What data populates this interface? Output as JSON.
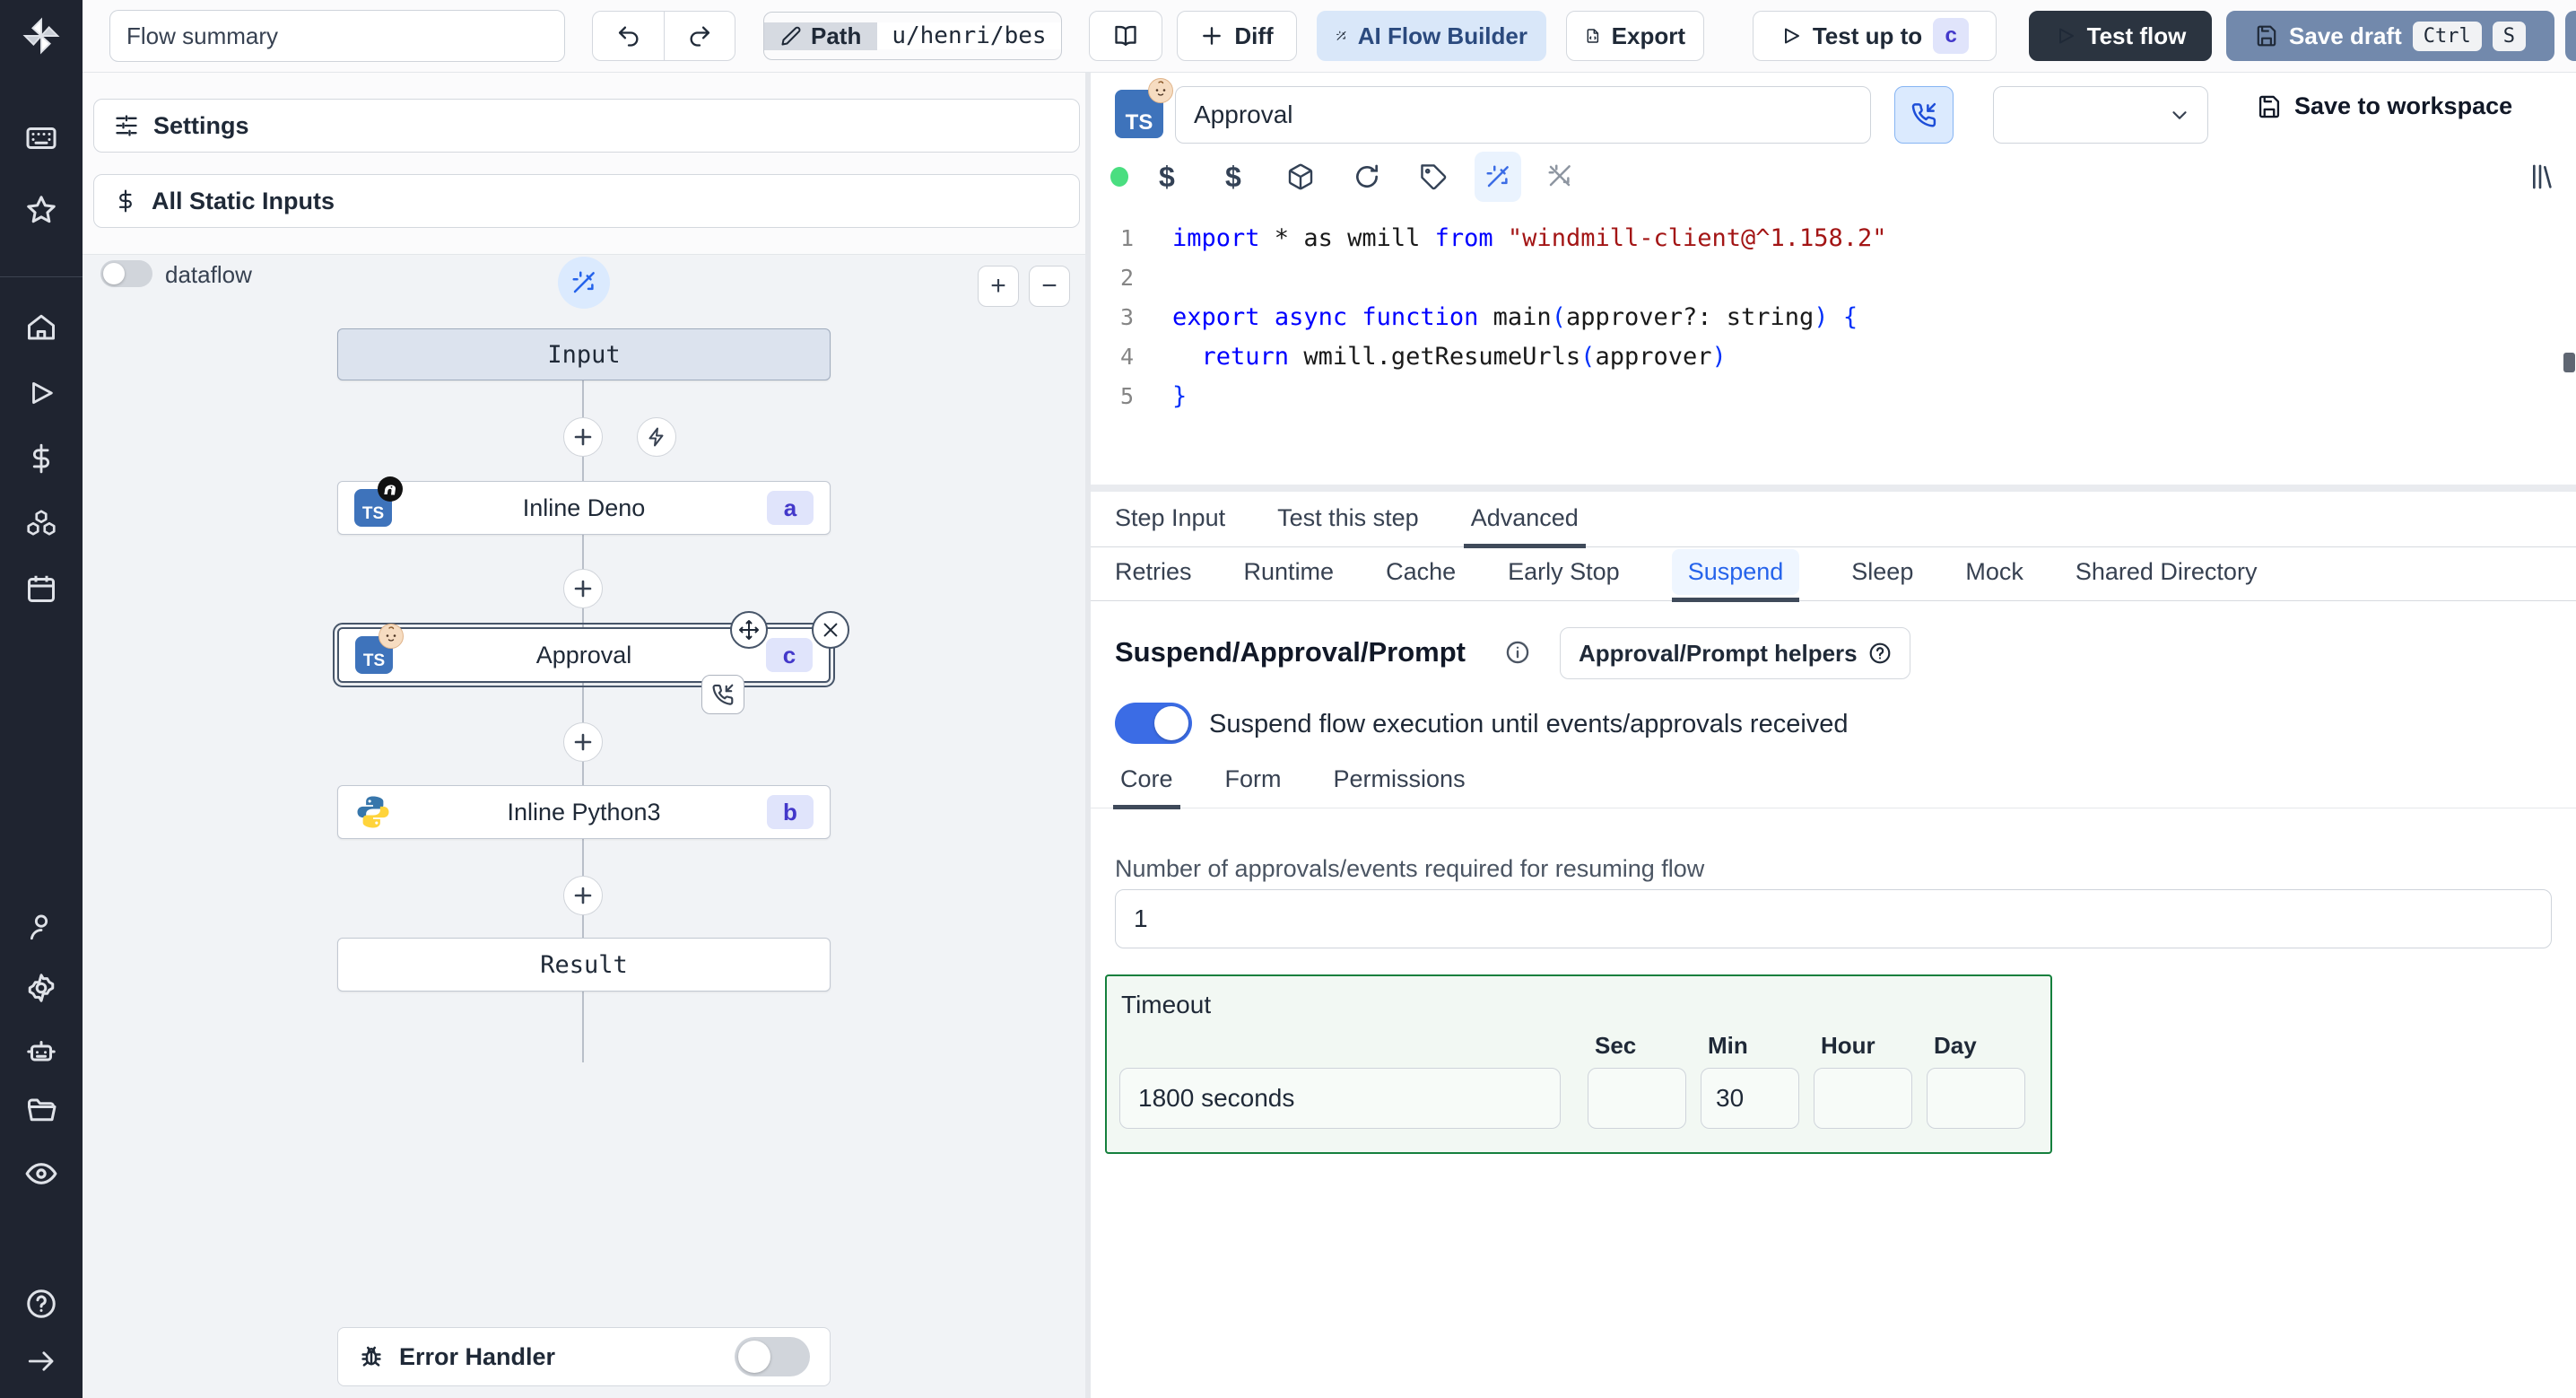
{
  "topbar": {
    "flow_summary_value": "Flow summary",
    "path": {
      "label": "Path",
      "value": "u/henri/bes"
    },
    "diff_label": "Diff",
    "ai_label": "AI Flow Builder",
    "export_label": "Export",
    "test_up_to_label": "Test up to",
    "test_up_to_badge": "c",
    "test_flow_label": "Test flow",
    "save_draft_label": "Save draft",
    "kbd_ctrl": "Ctrl",
    "kbd_s": "S"
  },
  "left_panel": {
    "settings_label": "Settings",
    "static_inputs_label": "All Static Inputs",
    "dataflow_label": "dataflow",
    "error_handler_label": "Error Handler"
  },
  "graph": {
    "ts": "TS",
    "nodes": {
      "input": {
        "label": "Input"
      },
      "deno": {
        "label": "Inline Deno",
        "badge": "a"
      },
      "approval": {
        "label": "Approval",
        "badge": "c"
      },
      "python": {
        "label": "Inline Python3",
        "badge": "b"
      },
      "result": {
        "label": "Result"
      }
    }
  },
  "step_header": {
    "name_value": "Approval",
    "save_to_workspace_label": "Save to workspace"
  },
  "editor": {
    "lines": [
      {
        "n": "1",
        "segs": [
          {
            "t": "import",
            "c": "kw"
          },
          {
            "t": " * as wmill ",
            "c": "pl"
          },
          {
            "t": "from",
            "c": "kw"
          },
          {
            "t": " ",
            "c": "pl"
          },
          {
            "t": "\"windmill-client@^1.158.2\"",
            "c": "str"
          }
        ]
      },
      {
        "n": "2",
        "segs": []
      },
      {
        "n": "3",
        "segs": [
          {
            "t": "export",
            "c": "kw"
          },
          {
            "t": " ",
            "c": "pl"
          },
          {
            "t": "async",
            "c": "kw"
          },
          {
            "t": " ",
            "c": "pl"
          },
          {
            "t": "function",
            "c": "kw"
          },
          {
            "t": " main",
            "c": "pl"
          },
          {
            "t": "(",
            "c": "br"
          },
          {
            "t": "approver?: string",
            "c": "pl"
          },
          {
            "t": ")",
            "c": "br"
          },
          {
            "t": " {",
            "c": "br"
          }
        ]
      },
      {
        "n": "4",
        "segs": [
          {
            "t": "  ",
            "c": "pl"
          },
          {
            "t": "return",
            "c": "kw"
          },
          {
            "t": " wmill.getResumeUrls",
            "c": "pl"
          },
          {
            "t": "(",
            "c": "br"
          },
          {
            "t": "approver",
            "c": "pl"
          },
          {
            "t": ")",
            "c": "br"
          }
        ]
      },
      {
        "n": "5",
        "segs": [
          {
            "t": "}",
            "c": "br"
          }
        ]
      }
    ]
  },
  "tabs": {
    "main": [
      {
        "label": "Step Input",
        "active": false
      },
      {
        "label": "Test this step",
        "active": false
      },
      {
        "label": "Advanced",
        "active": true
      }
    ],
    "advanced": [
      {
        "label": "Retries",
        "active": false
      },
      {
        "label": "Runtime",
        "active": false
      },
      {
        "label": "Cache",
        "active": false
      },
      {
        "label": "Early Stop",
        "active": false
      },
      {
        "label": "Suspend",
        "active": true
      },
      {
        "label": "Sleep",
        "active": false
      },
      {
        "label": "Mock",
        "active": false
      },
      {
        "label": "Shared Directory",
        "active": false
      }
    ],
    "suspend_sub": [
      {
        "label": "Core",
        "active": true
      },
      {
        "label": "Form",
        "active": false
      },
      {
        "label": "Permissions",
        "active": false
      }
    ]
  },
  "suspend": {
    "title": "Suspend/Approval/Prompt",
    "helpers_button_label": "Approval/Prompt helpers",
    "toggle_label": "Suspend flow execution until events/approvals received",
    "approvals_label": "Number of approvals/events required for resuming flow",
    "approvals_value": "1",
    "timeout": {
      "title": "Timeout",
      "display_value": "1800 seconds",
      "units": [
        {
          "label": "Sec",
          "value": ""
        },
        {
          "label": "Min",
          "value": "30"
        },
        {
          "label": "Hour",
          "value": ""
        },
        {
          "label": "Day",
          "value": ""
        }
      ]
    }
  },
  "colors": {
    "accent_blue": "#2563eb",
    "toggle_on": "#3b6ce5",
    "save_draft": "#7289ac",
    "test_flow_dark": "#2b3440",
    "timeout_green": "#15803d",
    "badge_indigo_bg": "#e0e4fb",
    "badge_indigo_text": "#4338ca"
  }
}
